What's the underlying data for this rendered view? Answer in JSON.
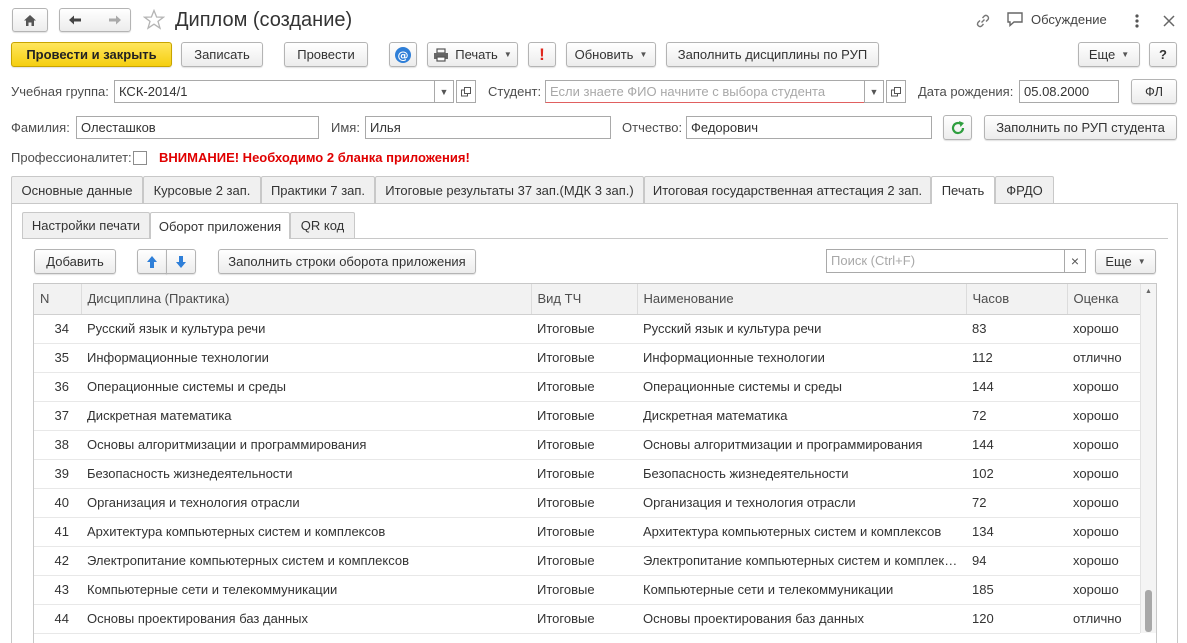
{
  "header": {
    "title": "Диплом (создание)",
    "discussion_label": "Обсуждение"
  },
  "toolbar": {
    "post_close": "Провести и закрыть",
    "save": "Записать",
    "post": "Провести",
    "print": "Печать",
    "alert_label": "!",
    "refresh": "Обновить",
    "fill_rup": "Заполнить дисциплины по РУП",
    "more": "Еще",
    "help": "?"
  },
  "form": {
    "group_label": "Учебная группа:",
    "group_value": "КСК-2014/1",
    "student_label": "Студент:",
    "student_placeholder": "Если знаете ФИО начните с выбора студента",
    "birth_label": "Дата рождения:",
    "birth_value": "05.08.2000",
    "fl_button": "ФЛ",
    "surname_label": "Фамилия:",
    "surname_value": "Олесташков",
    "name_label": "Имя:",
    "name_value": "Илья",
    "patronymic_label": "Отчество:",
    "patronymic_value": "Федорович",
    "fill_rup_student": "Заполнить по РУП студента",
    "prof_label": "Профессионалитет:",
    "warning": "ВНИМАНИЕ! Необходимо 2 бланка приложения!"
  },
  "tabs": [
    {
      "label": "Основные данные"
    },
    {
      "label": "Курсовые 2 зап."
    },
    {
      "label": "Практики 7 зап."
    },
    {
      "label": "Итоговые результаты 37 зап.(МДК 3 зап.)"
    },
    {
      "label": "Итоговая государственная аттестация 2 зап."
    },
    {
      "label": "Печать"
    },
    {
      "label": "ФРДО"
    }
  ],
  "subtabs": [
    {
      "label": "Настройки печати"
    },
    {
      "label": "Оборот приложения"
    },
    {
      "label": "QR код"
    }
  ],
  "subtoolbar": {
    "add": "Добавить",
    "fill_rows": "Заполнить строки оборота приложения",
    "search_placeholder": "Поиск (Ctrl+F)",
    "clear": "×",
    "more": "Еще"
  },
  "table": {
    "columns": [
      "N",
      "Дисциплина (Практика)",
      "Вид ТЧ",
      "Наименование",
      "Часов",
      "Оценка"
    ],
    "rows": [
      {
        "n": "34",
        "discipline": "Русский язык и культура речи",
        "kind": "Итоговые",
        "name": "Русский язык и культура речи",
        "hours": "83",
        "grade": "хорошо"
      },
      {
        "n": "35",
        "discipline": "Информационные технологии",
        "kind": "Итоговые",
        "name": "Информационные технологии",
        "hours": "112",
        "grade": "отлично"
      },
      {
        "n": "36",
        "discipline": "Операционные системы и среды",
        "kind": "Итоговые",
        "name": "Операционные системы и среды",
        "hours": "144",
        "grade": "хорошо"
      },
      {
        "n": "37",
        "discipline": "Дискретная математика",
        "kind": "Итоговые",
        "name": "Дискретная математика",
        "hours": "72",
        "grade": "хорошо"
      },
      {
        "n": "38",
        "discipline": "Основы алгоритмизации и программирования",
        "kind": "Итоговые",
        "name": "Основы алгоритмизации и программирования",
        "hours": "144",
        "grade": "хорошо"
      },
      {
        "n": "39",
        "discipline": "Безопасность жизнедеятельности",
        "kind": "Итоговые",
        "name": "Безопасность жизнедеятельности",
        "hours": "102",
        "grade": "хорошо"
      },
      {
        "n": "40",
        "discipline": "Организация и технология отрасли",
        "kind": "Итоговые",
        "name": "Организация и технология отрасли",
        "hours": "72",
        "grade": "хорошо"
      },
      {
        "n": "41",
        "discipline": "Архитектура компьютерных систем и комплексов",
        "kind": "Итоговые",
        "name": "Архитектура компьютерных систем и комплексов",
        "hours": "134",
        "grade": "хорошо"
      },
      {
        "n": "42",
        "discipline": "Электропитание компьютерных систем и комплексов",
        "kind": "Итоговые",
        "name": "Электропитание компьютерных систем и комплексов",
        "hours": "94",
        "grade": "хорошо"
      },
      {
        "n": "43",
        "discipline": "Компьютерные сети и телекоммуникации",
        "kind": "Итоговые",
        "name": "Компьютерные сети и телекоммуникации",
        "hours": "185",
        "grade": "хорошо"
      },
      {
        "n": "44",
        "discipline": "Основы проектирования баз данных",
        "kind": "Итоговые",
        "name": "Основы проектирования баз данных",
        "hours": "120",
        "grade": "отлично"
      }
    ]
  },
  "icons": {
    "home": "home-icon",
    "back": "arrow-left-icon",
    "forward": "arrow-right-icon",
    "star": "star-icon",
    "link": "link-icon",
    "chat": "chat-icon",
    "menu": "kebab-menu-icon",
    "close": "close-icon",
    "email": "email-icon",
    "printer": "printer-icon",
    "dropdown": "dropdown-icon",
    "open": "open-window-icon",
    "refresh": "refresh-icon",
    "up": "arrow-up-icon",
    "down": "arrow-down-icon"
  },
  "colors": {
    "primary_button": "#f5cf10",
    "warning_text": "#e00000",
    "refresh_green": "#2e9e3e",
    "arrow_blue": "#2f7fd8",
    "email_blue": "#2f7fd8",
    "alert_red": "#e0281e"
  }
}
